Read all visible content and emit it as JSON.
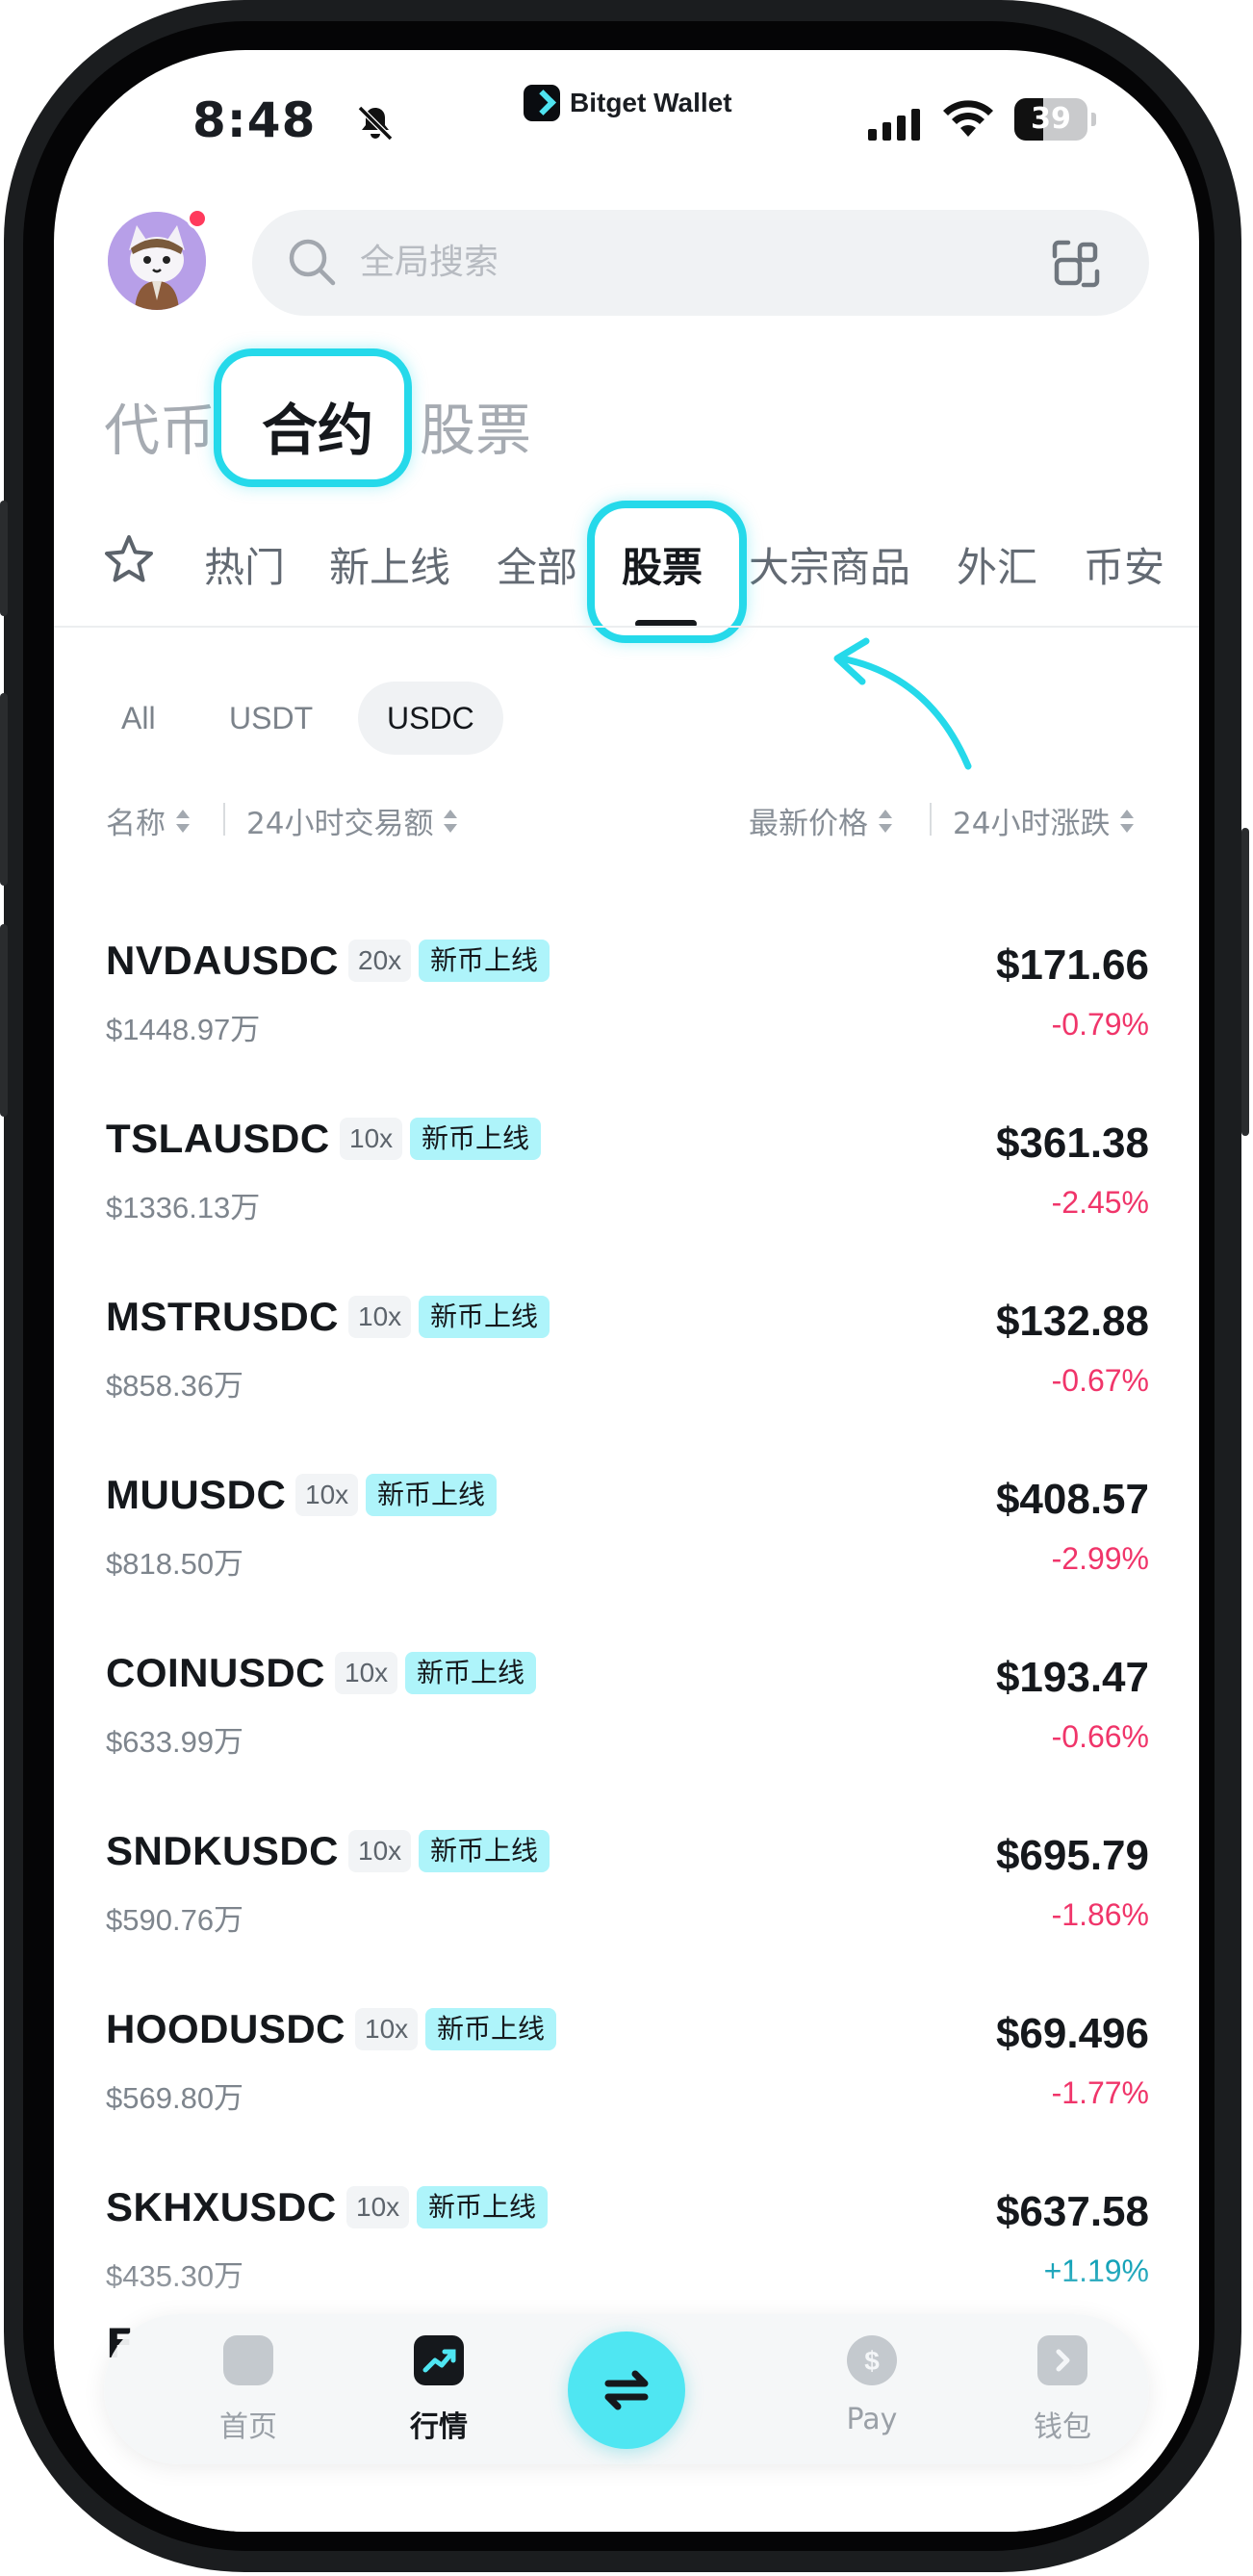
{
  "status": {
    "time": "8:48",
    "app_brand": "Bitget Wallet",
    "battery_level": "39"
  },
  "search": {
    "placeholder": "全局搜索"
  },
  "top_tabs": [
    {
      "label": "代币",
      "active": false
    },
    {
      "label": "合约",
      "active": true
    },
    {
      "label": "股票",
      "active": false
    }
  ],
  "category_tabs": [
    {
      "label": "热门",
      "active": false
    },
    {
      "label": "新上线",
      "active": false
    },
    {
      "label": "全部",
      "active": false
    },
    {
      "label": "股票",
      "active": true
    },
    {
      "label": "大宗商品",
      "active": false
    },
    {
      "label": "外汇",
      "active": false
    },
    {
      "label": "币安",
      "active": false
    }
  ],
  "quote_filters": [
    {
      "label": "All",
      "active": false
    },
    {
      "label": "USDT",
      "active": false
    },
    {
      "label": "USDC",
      "active": true
    }
  ],
  "columns": {
    "name": "名称",
    "volume": "24小时交易额",
    "price": "最新价格",
    "change": "24小时涨跌"
  },
  "rows": [
    {
      "symbol": "NVDAUSDC",
      "leverage": "20x",
      "tag": "新币上线",
      "volume": "$1448.97万",
      "price": "$171.66",
      "change": "-0.79%",
      "direction": "down"
    },
    {
      "symbol": "TSLAUSDC",
      "leverage": "10x",
      "tag": "新币上线",
      "volume": "$1336.13万",
      "price": "$361.38",
      "change": "-2.45%",
      "direction": "down"
    },
    {
      "symbol": "MSTRUSDC",
      "leverage": "10x",
      "tag": "新币上线",
      "volume": "$858.36万",
      "price": "$132.88",
      "change": "-0.67%",
      "direction": "down"
    },
    {
      "symbol": "MUUSDC",
      "leverage": "10x",
      "tag": "新币上线",
      "volume": "$818.50万",
      "price": "$408.57",
      "change": "-2.99%",
      "direction": "down"
    },
    {
      "symbol": "COINUSDC",
      "leverage": "10x",
      "tag": "新币上线",
      "volume": "$633.99万",
      "price": "$193.47",
      "change": "-0.66%",
      "direction": "down"
    },
    {
      "symbol": "SNDKUSDC",
      "leverage": "10x",
      "tag": "新币上线",
      "volume": "$590.76万",
      "price": "$695.79",
      "change": "-1.86%",
      "direction": "down"
    },
    {
      "symbol": "HOODUSDC",
      "leverage": "10x",
      "tag": "新币上线",
      "volume": "$569.80万",
      "price": "$69.496",
      "change": "-1.77%",
      "direction": "down"
    },
    {
      "symbol": "SKHXUSDC",
      "leverage": "10x",
      "tag": "新币上线",
      "volume": "$435.30万",
      "price": "$637.58",
      "change": "+1.19%",
      "direction": "up"
    }
  ],
  "bottom_nav": [
    {
      "label": "首页",
      "icon": "home-icon",
      "active": false
    },
    {
      "label": "行情",
      "icon": "market-chart-icon",
      "active": true
    },
    {
      "label": "",
      "icon": "swap-icon",
      "active": false
    },
    {
      "label": "Pay",
      "icon": "pay-icon",
      "active": false
    },
    {
      "label": "钱包",
      "icon": "wallet-icon",
      "active": false
    }
  ],
  "colors": {
    "accent_cyan": "#4fe6f2",
    "highlight_outline": "#25d9ea",
    "down_red": "#f0356a",
    "up_teal": "#14a2b8",
    "tag_bg": "#aef4fa"
  }
}
